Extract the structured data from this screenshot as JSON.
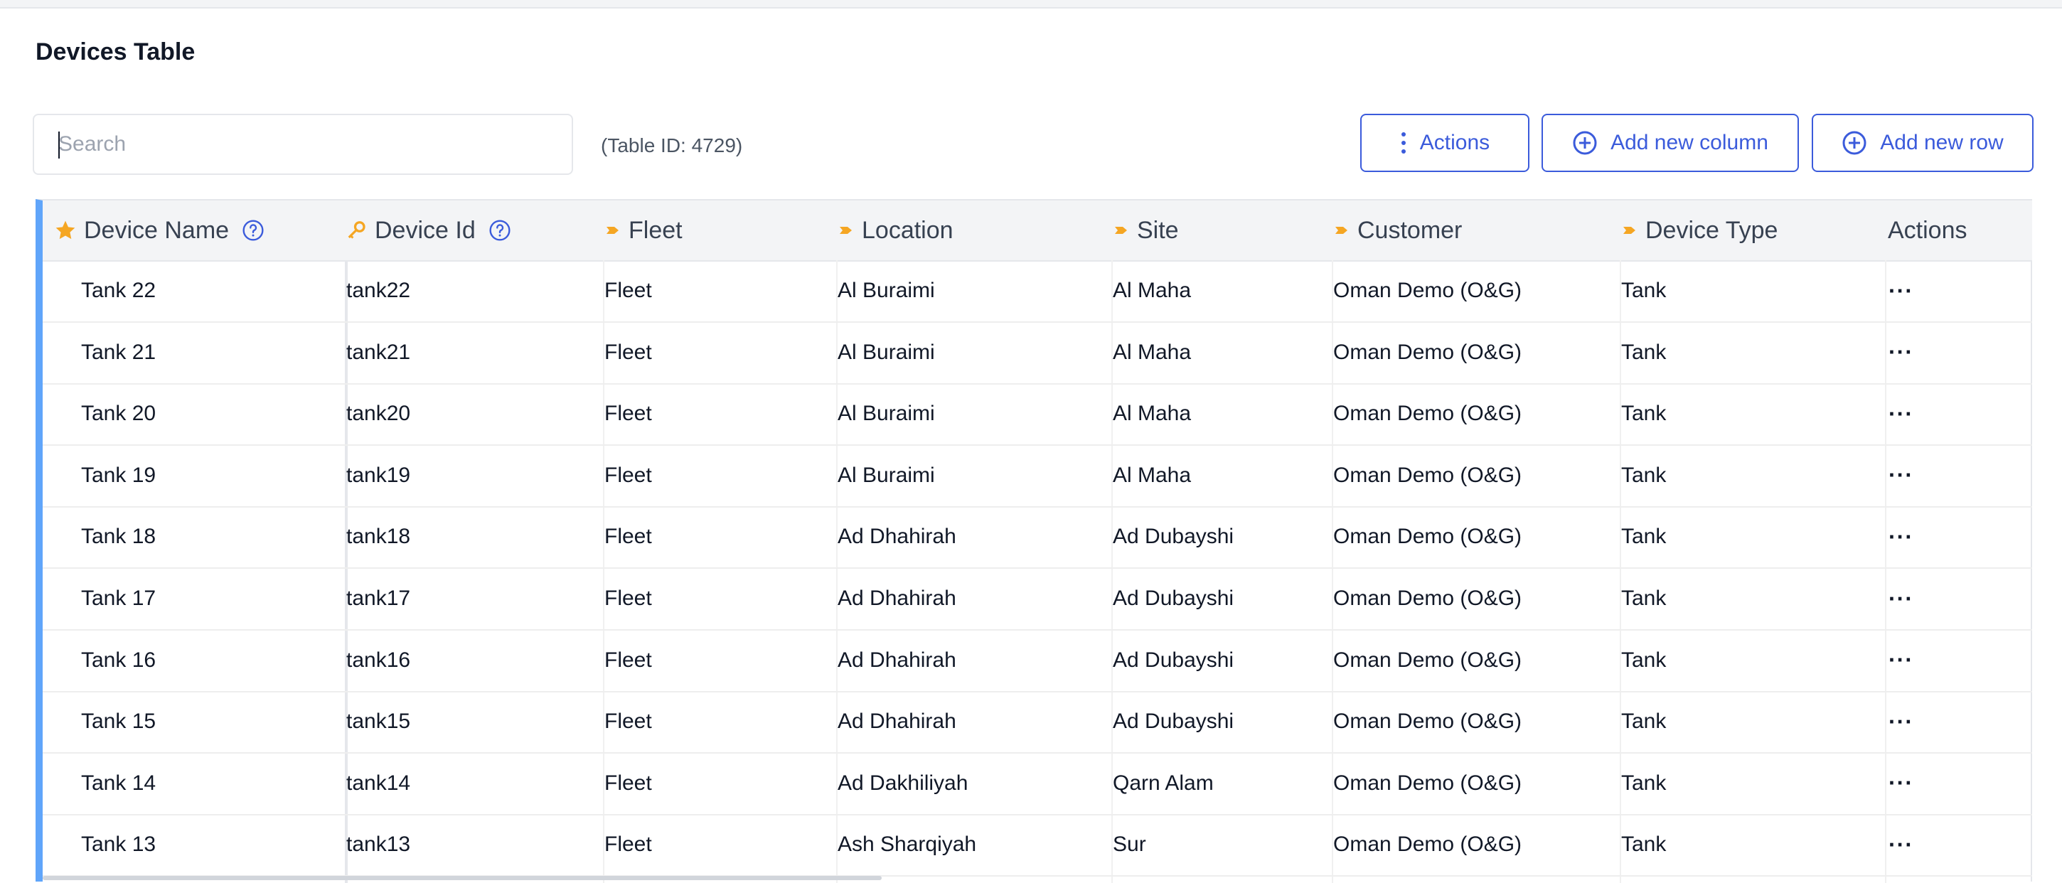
{
  "page": {
    "title": "Devices Table",
    "table_id_text": "(Table ID: 4729)"
  },
  "search": {
    "placeholder": "Search",
    "value": ""
  },
  "toolbar": {
    "actions_label": "Actions",
    "add_column_label": "Add new column",
    "add_row_label": "Add new row"
  },
  "colors": {
    "accent": "#3b5bdb",
    "row_marker": "#60a5fa",
    "star": "#f5a623",
    "header_bg": "#f3f4f6"
  },
  "table": {
    "columns": [
      {
        "label": "Device Name",
        "icon": "star-icon",
        "help": true
      },
      {
        "label": "Device Id",
        "icon": "key-icon",
        "help": true
      },
      {
        "label": "Fleet",
        "icon": "tag-icon",
        "help": false
      },
      {
        "label": "Location",
        "icon": "tag-icon",
        "help": false
      },
      {
        "label": "Site",
        "icon": "tag-icon",
        "help": false
      },
      {
        "label": "Customer",
        "icon": "tag-icon",
        "help": false
      },
      {
        "label": "Device Type",
        "icon": "tag-icon",
        "help": false
      },
      {
        "label": "Actions",
        "icon": "",
        "help": false
      }
    ],
    "rows": [
      [
        "Tank 22",
        "tank22",
        "Fleet",
        "Al Buraimi",
        "Al Maha",
        "Oman Demo (O&G)",
        "Tank"
      ],
      [
        "Tank 21",
        "tank21",
        "Fleet",
        "Al Buraimi",
        "Al Maha",
        "Oman Demo (O&G)",
        "Tank"
      ],
      [
        "Tank 20",
        "tank20",
        "Fleet",
        "Al Buraimi",
        "Al Maha",
        "Oman Demo (O&G)",
        "Tank"
      ],
      [
        "Tank 19",
        "tank19",
        "Fleet",
        "Al Buraimi",
        "Al Maha",
        "Oman Demo (O&G)",
        "Tank"
      ],
      [
        "Tank 18",
        "tank18",
        "Fleet",
        "Ad Dhahirah",
        "Ad Dubayshi",
        "Oman Demo (O&G)",
        "Tank"
      ],
      [
        "Tank 17",
        "tank17",
        "Fleet",
        "Ad Dhahirah",
        "Ad Dubayshi",
        "Oman Demo (O&G)",
        "Tank"
      ],
      [
        "Tank 16",
        "tank16",
        "Fleet",
        "Ad Dhahirah",
        "Ad Dubayshi",
        "Oman Demo (O&G)",
        "Tank"
      ],
      [
        "Tank 15",
        "tank15",
        "Fleet",
        "Ad Dhahirah",
        "Ad Dubayshi",
        "Oman Demo (O&G)",
        "Tank"
      ],
      [
        "Tank 14",
        "tank14",
        "Fleet",
        "Ad Dakhiliyah",
        "Qarn Alam",
        "Oman Demo (O&G)",
        "Tank"
      ],
      [
        "Tank 13",
        "tank13",
        "Fleet",
        "Ash Sharqiyah",
        "Sur",
        "Oman Demo (O&G)",
        "Tank"
      ]
    ],
    "row_actions_glyph": "···"
  }
}
